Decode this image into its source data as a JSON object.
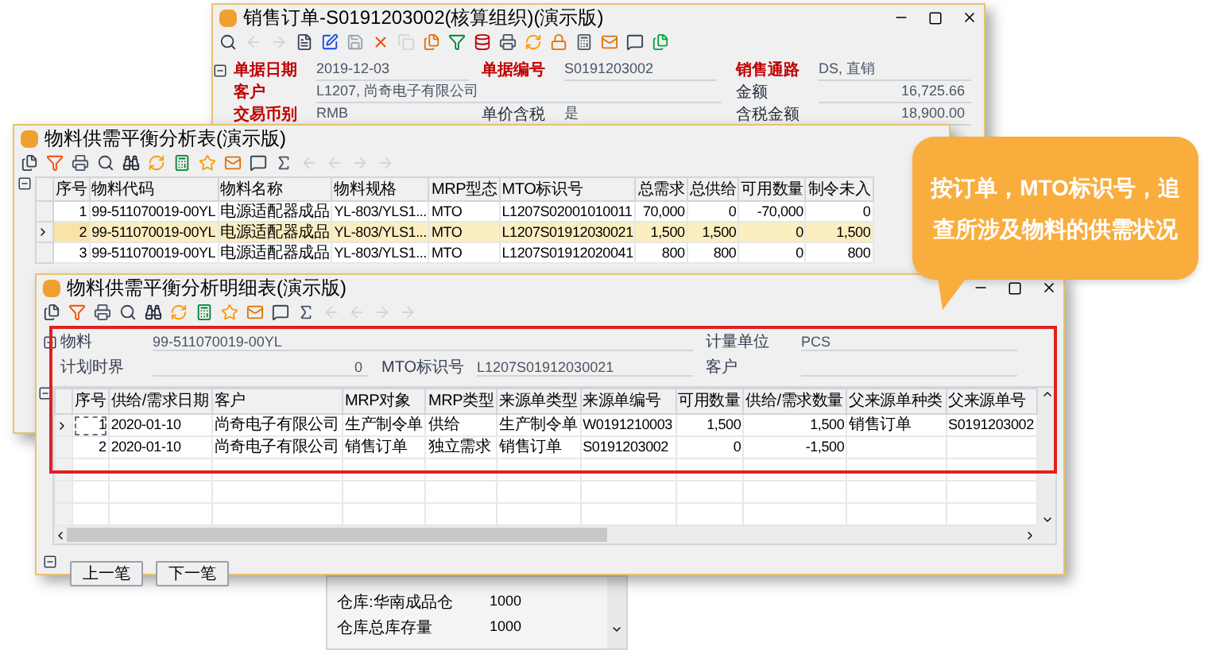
{
  "sales_order": {
    "title": "销售订单-S0191203002(核算组织)(演示版)",
    "rows": [
      [
        {
          "label": "单据日期",
          "required": true,
          "value": "2019-12-03"
        },
        {
          "label": "单据编号",
          "required": true,
          "value": "S0191203002"
        },
        {
          "label": "销售通路",
          "required": true,
          "value": "DS, 直销"
        }
      ],
      [
        {
          "label": "客户",
          "required": true,
          "value": "L1207, 尚奇电子有限公司"
        },
        null,
        {
          "label": "金额",
          "required": false,
          "value": "16,725.66"
        }
      ],
      [
        {
          "label": "交易币别",
          "required": true,
          "value": "RMB"
        },
        {
          "label": "单价含税",
          "required": false,
          "value": "是"
        },
        {
          "label": "含税金额",
          "required": false,
          "value": "18,900.00"
        }
      ]
    ]
  },
  "balance_window": {
    "title": "物料供需平衡分析表(演示版)",
    "columns": [
      "序号",
      "物料代码",
      "物料名称",
      "物料规格",
      "MRP型态",
      "MTO标识号",
      "总需求",
      "总供给",
      "可用数量",
      "制令未入"
    ],
    "rows": [
      {
        "selected": false,
        "cells": [
          "1",
          "99-511070019-00YL",
          "电源适配器成品",
          "YL-803/YLS1...",
          "MTO",
          "L1207S02001010011",
          "70,000",
          "0",
          "-70,000",
          "0"
        ]
      },
      {
        "selected": true,
        "cells": [
          "2",
          "99-511070019-00YL",
          "电源适配器成品",
          "YL-803/YLS1...",
          "MTO",
          "L1207S01912030021",
          "1,500",
          "1,500",
          "0",
          "1,500"
        ]
      },
      {
        "selected": false,
        "cells": [
          "3",
          "99-511070019-00YL",
          "电源适配器成品",
          "YL-803/YLS1...",
          "MTO",
          "L1207S01912020041",
          "800",
          "800",
          "0",
          "800"
        ]
      }
    ]
  },
  "detail_window": {
    "title": "物料供需平衡分析明细表(演示版)",
    "form": [
      [
        {
          "label": "物料",
          "value": "99-511070019-00YL"
        },
        {
          "label": "计量单位",
          "value": "PCS"
        }
      ],
      [
        {
          "label": "计划时界",
          "value": "0"
        },
        {
          "label": "MTO标识号",
          "value": "L1207S01912030021"
        },
        {
          "label": "客户"
        }
      ]
    ],
    "columns": [
      "序号",
      "供给/需求日期",
      "客户",
      "MRP对象",
      "MRP类型",
      "来源单类型",
      "来源单编号",
      "可用数量",
      "供给/需求数量",
      "父来源单种类",
      "父来源单号"
    ],
    "rows": [
      {
        "selected": true,
        "cells": [
          "1",
          "2020-01-10",
          "尚奇电子有限公司",
          "生产制令单",
          "供给",
          "生产制令单",
          "W0191210003",
          "1,500",
          "1,500",
          "销售订单",
          "S0191203002"
        ]
      },
      {
        "selected": false,
        "cells": [
          "2",
          "2020-01-10",
          "尚奇电子有限公司",
          "销售订单",
          "独立需求",
          "销售订单",
          "S0191203002",
          "0",
          "-1,500"
        ]
      }
    ],
    "buttons": [
      "上一笔",
      "下一笔"
    ]
  },
  "stock_panel": {
    "rows": [
      {
        "label": "仓库:华南成品仓",
        "value": "1000"
      },
      {
        "label": "仓库总库存量",
        "value": "1000"
      }
    ]
  },
  "callout": {
    "text": "按订单，MTO标识号，追查所涉及物料的供需状况"
  }
}
